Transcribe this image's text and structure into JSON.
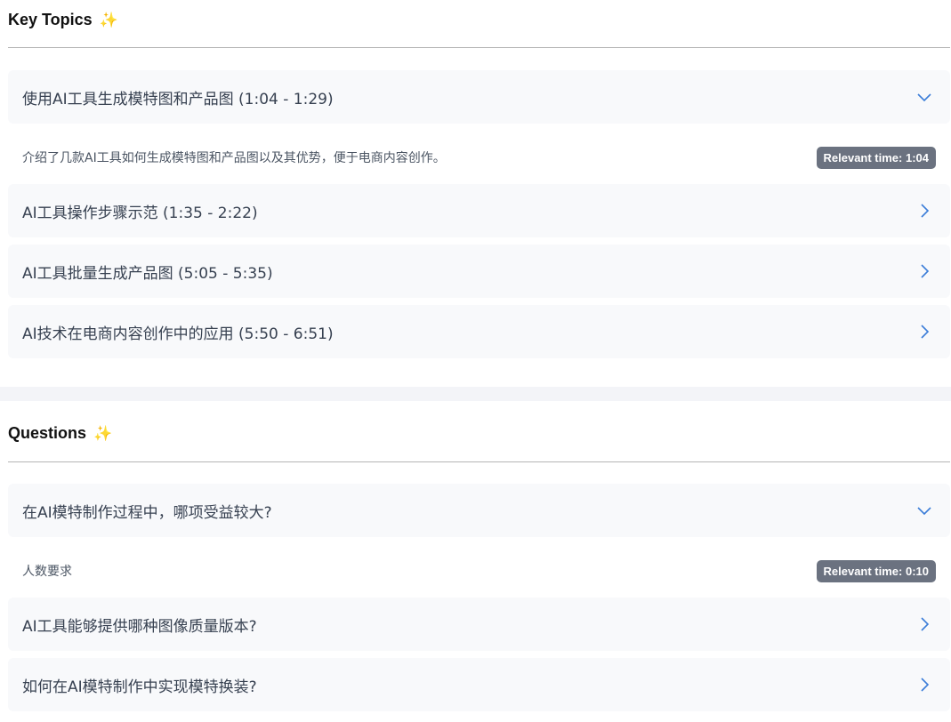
{
  "key_topics": {
    "title": "Key Topics",
    "sparkle": "✨",
    "items": [
      {
        "label": "使用AI工具生成模特图和产品图 (1:04 - 1:29)",
        "expanded": true,
        "detail": "介绍了几款AI工具如何生成模特图和产品图以及其优势，便于电商内容创作。",
        "badge": "Relevant time: 1:04"
      },
      {
        "label": "AI工具操作步骤示范 (1:35 - 2:22)",
        "expanded": false
      },
      {
        "label": "AI工具批量生成产品图 (5:05 - 5:35)",
        "expanded": false
      },
      {
        "label": "AI技术在电商内容创作中的应用 (5:50 - 6:51)",
        "expanded": false
      }
    ]
  },
  "questions": {
    "title": "Questions",
    "sparkle": "✨",
    "items": [
      {
        "label": "在AI模特制作过程中，哪项受益较大?",
        "expanded": true,
        "detail": "人数要求",
        "badge": "Relevant time: 0:10"
      },
      {
        "label": "AI工具能够提供哪种图像质量版本?",
        "expanded": false
      },
      {
        "label": "如何在AI模特制作中实现模特换装?",
        "expanded": false
      }
    ]
  },
  "colors": {
    "chevron": "#3b7dd8",
    "badge_bg": "#6b7280",
    "card_bg": "#f8f9fb"
  },
  "icons": {
    "expanded": "chevron-down-icon",
    "collapsed": "chevron-right-icon"
  }
}
